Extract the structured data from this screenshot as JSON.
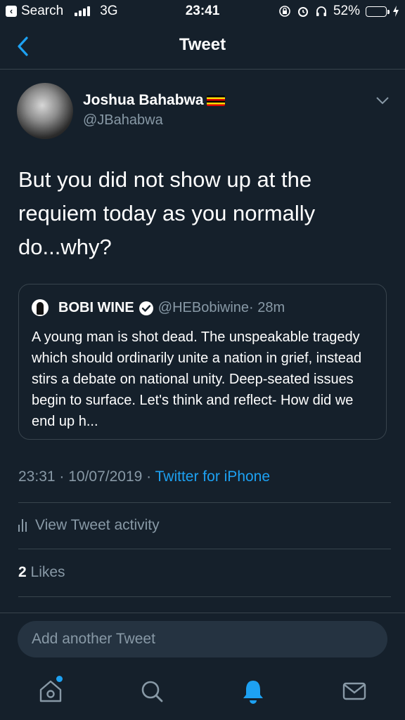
{
  "status_bar": {
    "carrier_back": "Search",
    "network": "3G",
    "time": "23:41",
    "battery": "52%",
    "battery_level": 0.52
  },
  "nav": {
    "title": "Tweet"
  },
  "author": {
    "name": "Joshua Bahabwa",
    "handle": "@JBahabwa"
  },
  "tweet": {
    "text": "But you did not show up at the requiem today as you normally do...why?",
    "timestamp": "23:31 · 10/07/2019",
    "separator": " · ",
    "source": "Twitter for iPhone"
  },
  "quoted_tweet": {
    "name": "BOBI WINE",
    "handle": "@HEBobiwine",
    "time": " · 28m",
    "text": "A young man is shot dead. The unspeakable tragedy which should ordinarily unite a nation in grief, instead stirs a debate on national unity. Deep-seated issues begin to surface. Let's think and reflect- How did we end up h..."
  },
  "activity": {
    "label": "View Tweet activity"
  },
  "likes": {
    "count": "2",
    "label": "Likes"
  },
  "compose": {
    "placeholder": "Add another Tweet"
  },
  "tabs": [
    "home-icon",
    "search-icon",
    "notifications-icon",
    "messages-icon"
  ],
  "colors": {
    "background": "#15202b",
    "accent": "#1da1f2",
    "secondary_text": "#8899a6",
    "divider": "#38444d"
  }
}
